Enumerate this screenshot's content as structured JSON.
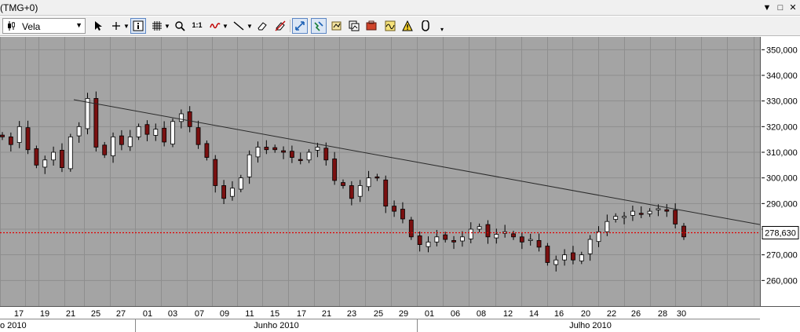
{
  "window": {
    "title": "(TMG+0)",
    "buttons": {
      "menu_glyph": "▼",
      "restore_glyph": "□",
      "close_glyph": "✕"
    }
  },
  "toolbar": {
    "chart_type": {
      "selected": "Vela"
    },
    "tools": [
      {
        "name": "cursor-arrow-icon"
      },
      {
        "name": "crosshair-icon",
        "has_dropdown": true
      },
      {
        "name": "info-icon",
        "active": true
      },
      {
        "name": "grid-icon",
        "has_dropdown": true
      },
      {
        "name": "zoom-icon"
      },
      {
        "name": "one-to-one-icon",
        "label": "1:1"
      },
      {
        "name": "indicator-wave-icon",
        "has_dropdown": true
      },
      {
        "name": "trendline-icon",
        "has_dropdown": true
      },
      {
        "name": "eraser-icon"
      },
      {
        "name": "eraser-all-icon"
      },
      {
        "name": "autoscale-icon",
        "active": true
      },
      {
        "name": "magnet-icon",
        "active": true
      },
      {
        "name": "template-icon"
      },
      {
        "name": "compare-icon"
      },
      {
        "name": "portfolio-icon"
      },
      {
        "name": "studies-icon"
      },
      {
        "name": "alert-icon"
      },
      {
        "name": "lock-icon"
      },
      {
        "name": "more-icon"
      }
    ]
  },
  "colors": {
    "plot_bg": "#a4a4a4",
    "grid": "#8e8e8e",
    "candle_up": "#ffffff",
    "candle_down": "#7a1010",
    "wick": "#000000",
    "trendline": "#2a2a2a",
    "price_line": "#e00000"
  },
  "chart_data": {
    "type": "candlestick",
    "ylim": [
      250000,
      355000
    ],
    "y_ticks": [
      "260,000",
      "270,000",
      "280,000",
      "290,000",
      "300,000",
      "310,000",
      "320,000",
      "330,000",
      "340,000",
      "350,000"
    ],
    "y_tick_values": [
      260000,
      270000,
      280000,
      290000,
      300000,
      310000,
      320000,
      330000,
      340000,
      350000
    ],
    "current_price": 278630,
    "current_price_label": "278,630",
    "day_labels": [
      "17",
      "19",
      "21",
      "25",
      "27",
      "01",
      "03",
      "07",
      "09",
      "11",
      "15",
      "17",
      "21",
      "23",
      "25",
      "29",
      "01",
      "06",
      "08",
      "12",
      "14",
      "16",
      "20",
      "22",
      "26",
      "28",
      "30"
    ],
    "month_labels": [
      "o 2010",
      "Junho 2010",
      "Julho 2010"
    ],
    "trendline": {
      "from": [
        21.5,
        330500
      ],
      "to": [
        34.5,
        281800
      ]
    },
    "closes": [
      316000,
      313000,
      320000,
      311000,
      305000,
      307000,
      310000,
      304000,
      316000,
      320000,
      331000,
      312000,
      309000,
      316000,
      313000,
      316000,
      320000,
      317000,
      319000,
      314000,
      322000,
      325000,
      320000,
      313000,
      308000,
      297000,
      292000,
      296000,
      300000,
      309000,
      312000,
      311000,
      311000,
      310000,
      308000,
      307000,
      310000,
      312000,
      307000,
      299000,
      297000,
      292000,
      297000,
      300000,
      300000,
      289000,
      287000,
      284000,
      277000,
      274000,
      275000,
      277000,
      276000,
      275000,
      277000,
      280000,
      281000,
      277000,
      278000,
      279000,
      277000,
      275000,
      276000,
      273000,
      267000,
      268000,
      270000,
      268000,
      270000,
      276000,
      279000,
      283000,
      285000,
      285000,
      287000,
      286000,
      287000,
      288000,
      287000,
      282000,
      277000
    ]
  }
}
